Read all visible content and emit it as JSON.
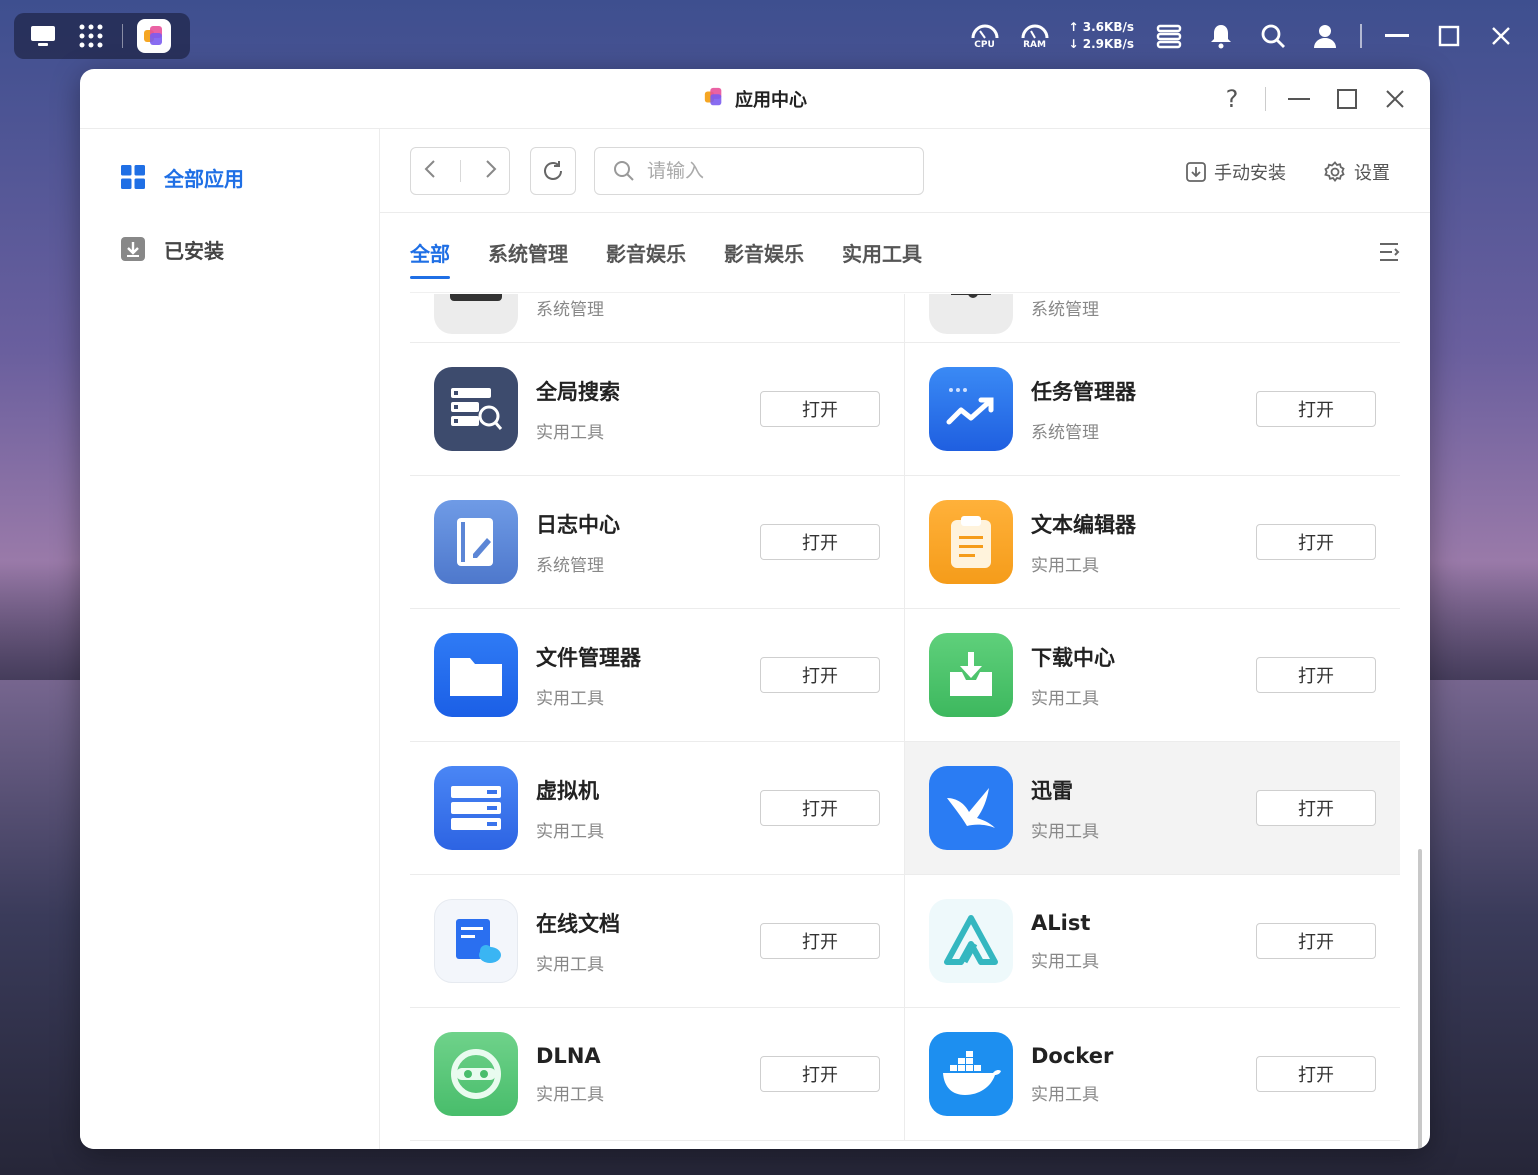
{
  "taskbar": {
    "cpu_label": "CPU",
    "ram_label": "RAM",
    "upload": "↑ 3.6KB/s",
    "download": "↓ 2.9KB/s"
  },
  "window": {
    "title": "应用中心"
  },
  "sidebar": {
    "items": [
      {
        "label": "全部应用"
      },
      {
        "label": "已安装"
      }
    ]
  },
  "toolbar": {
    "search_placeholder": "请输入",
    "manual_install": "手动安装",
    "settings": "设置"
  },
  "tabs": [
    "全部",
    "系统管理",
    "影音娱乐",
    "影音娱乐",
    "实用工具"
  ],
  "apps": {
    "partial_left_cat": "系统管理",
    "partial_right_cat": "系统管理",
    "open_label": "打开",
    "list": [
      {
        "name": "全局搜索",
        "category": "实用工具",
        "icon": "global-search-icon"
      },
      {
        "name": "任务管理器",
        "category": "系统管理",
        "icon": "task-manager-icon"
      },
      {
        "name": "日志中心",
        "category": "系统管理",
        "icon": "log-center-icon"
      },
      {
        "name": "文本编辑器",
        "category": "实用工具",
        "icon": "text-editor-icon"
      },
      {
        "name": "文件管理器",
        "category": "实用工具",
        "icon": "file-manager-icon"
      },
      {
        "name": "下载中心",
        "category": "实用工具",
        "icon": "download-center-icon"
      },
      {
        "name": "虚拟机",
        "category": "实用工具",
        "icon": "virtual-machine-icon"
      },
      {
        "name": "迅雷",
        "category": "实用工具",
        "icon": "xunlei-icon"
      },
      {
        "name": "在线文档",
        "category": "实用工具",
        "icon": "online-docs-icon"
      },
      {
        "name": "AList",
        "category": "实用工具",
        "icon": "alist-icon"
      },
      {
        "name": "DLNA",
        "category": "实用工具",
        "icon": "dlna-icon"
      },
      {
        "name": "Docker",
        "category": "实用工具",
        "icon": "docker-icon"
      }
    ]
  },
  "colors": {
    "accent": "#1f6fe5"
  }
}
